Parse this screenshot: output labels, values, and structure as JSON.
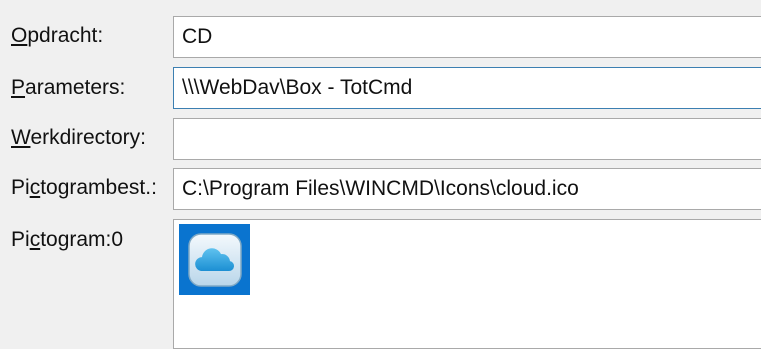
{
  "fields": [
    {
      "label_pre": "",
      "label_u": "O",
      "label_post": "pdracht:",
      "value": "CD"
    },
    {
      "label_pre": "",
      "label_u": "P",
      "label_post": "arameters:",
      "value": "\\\\\\WebDav\\Box - TotCmd"
    },
    {
      "label_pre": "",
      "label_u": "W",
      "label_post": "erkdirectory:",
      "value": ""
    },
    {
      "label_pre": "Pi",
      "label_u": "c",
      "label_post": "togrambest.:",
      "value": "C:\\Program Files\\WINCMD\\Icons\\cloud.ico"
    }
  ],
  "icon_section": {
    "label_pre": "Pi",
    "label_u": "c",
    "label_post": "togram:0",
    "icon": "cloud-icon",
    "selected_color": "#0a74cf"
  }
}
